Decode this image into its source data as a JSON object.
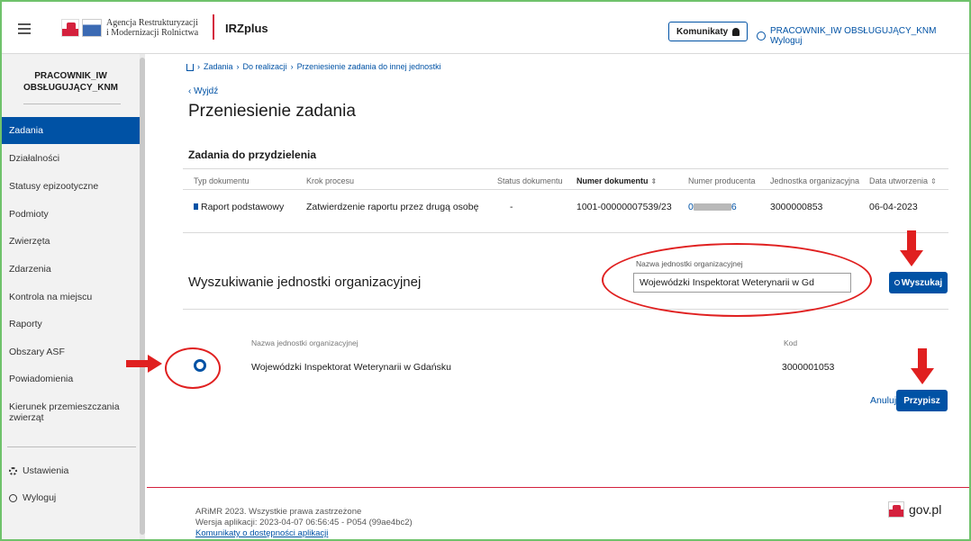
{
  "header": {
    "logo_text_line1": "Agencja Restrukturyzacji",
    "logo_text_line2": "i Modernizacji Rolnictwa",
    "app_name": "IRZplus",
    "komunikaty_label": "Komunikaty",
    "user_label": "PRACOWNIK_IW OBSŁUGUJĄCY_KNM Wyloguj"
  },
  "sidebar": {
    "user_line1": "PRACOWNIK_IW",
    "user_line2": "OBSŁUGUJĄCY_KNM",
    "items": [
      {
        "label": "Zadania"
      },
      {
        "label": "Działalności"
      },
      {
        "label": "Statusy epizootyczne"
      },
      {
        "label": "Podmioty"
      },
      {
        "label": "Zwierzęta"
      },
      {
        "label": "Zdarzenia"
      },
      {
        "label": "Kontrola na miejscu"
      },
      {
        "label": "Raporty"
      },
      {
        "label": "Obszary ASF"
      },
      {
        "label": "Powiadomienia"
      },
      {
        "label": "Kierunek przemieszczania zwierząt"
      }
    ],
    "settings_label": "Ustawienia",
    "logout_label": "Wyloguj"
  },
  "breadcrumb": {
    "items": [
      "Zadania",
      "Do realizacji",
      "Przeniesienie zadania do innej jednostki"
    ]
  },
  "back_label": "Wyjdź",
  "page_title": "Przeniesienie zadania",
  "tasks": {
    "title": "Zadania do przydzielenia",
    "columns": [
      "Typ dokumentu",
      "Krok procesu",
      "Status dokumentu",
      "Numer dokumentu",
      "Numer producenta",
      "Jednostka organizacyjna",
      "Data utworzenia"
    ],
    "row": {
      "typ": "Raport podstawowy",
      "krok": "Zatwierdzenie raportu przez drugą osobę",
      "status": "-",
      "numer": "1001-00000007539/23",
      "producent_prefix": "0",
      "producent_suffix": "6",
      "jednostka": "3000000853",
      "data": "06-04-2023"
    }
  },
  "search": {
    "title": "Wyszukiwanie jednostki organizacyjnej",
    "field_label": "Nazwa jednostki organizacyjnej",
    "field_value": "Wojewódzki Inspektorat Weterynarii w Gd",
    "button_label": "Wyszukaj"
  },
  "results": {
    "col_name": "Nazwa jednostki organizacyjnej",
    "col_code": "Kod",
    "row_name": "Wojewódzki Inspektorat Weterynarii w Gdańsku",
    "row_code": "3000001053",
    "cancel_label": "Anuluj",
    "assign_label": "Przypisz"
  },
  "footer": {
    "copyright": "ARiMR 2023. Wszystkie prawa zastrzeżone",
    "version": "Wersja aplikacji: 2023-04-07 06:56:45 - P054 (99ae4bc2)",
    "accessibility_link": "Komunikaty o dostępności aplikacji",
    "gov_label": "gov.pl"
  },
  "colors": {
    "primary": "#0052a5",
    "annotation": "#e02020",
    "footer_accent": "#d4213d"
  }
}
